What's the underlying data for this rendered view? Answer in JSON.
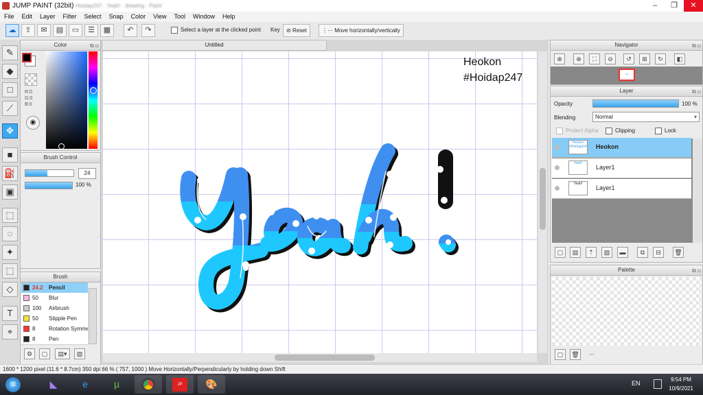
{
  "window": {
    "title": "JUMP PAINT (32bit)",
    "blurred_tabs": "Hoidap247 . Yeah! . drawing - Paint",
    "min": "–",
    "max": "❐",
    "close": "✕"
  },
  "menu": [
    "File",
    "Edit",
    "Layer",
    "Filter",
    "Select",
    "Snap",
    "Color",
    "View",
    "Tool",
    "Window",
    "Help"
  ],
  "toolbar": {
    "select_layer_label": "Select a layer at the clicked point",
    "key_label": "Key",
    "reset_label": "Reset",
    "move_label": "Move horizontally/vertically"
  },
  "color_panel": {
    "title": "Color",
    "r": "R:0",
    "g": "G:0",
    "b": "B:0",
    "fg": "#000000",
    "bg": "#ffffff"
  },
  "brush_control": {
    "title": "Brush Control",
    "size": "24",
    "opacity": "100 %",
    "size_fill": 0.45,
    "opacity_fill": 1.0
  },
  "brush": {
    "title": "Brush",
    "items": [
      {
        "size": "24.2",
        "name": "Pencil",
        "color": "#222222"
      },
      {
        "size": "50",
        "name": "Blur",
        "color": "#f4b6e6"
      },
      {
        "size": "100",
        "name": "Airbrush",
        "color": "#cccccc"
      },
      {
        "size": "50",
        "name": "Stipple Pen",
        "color": "#f2e62e"
      },
      {
        "size": "8",
        "name": "Rotation Symmetry",
        "color": "#ff3333"
      },
      {
        "size": "8",
        "name": "Pen",
        "color": "#222222"
      }
    ]
  },
  "canvas": {
    "tab": "Untitled",
    "watermark_line1": "Heokon",
    "watermark_line2": "#Hoidap247"
  },
  "navigator": {
    "title": "Navigator"
  },
  "layer_panel": {
    "title": "Layer",
    "opacity_label": "Opacity",
    "opacity_value": "100 %",
    "opacity_fill": 1.0,
    "blending_label": "Blending",
    "blending_value": "Normal",
    "protect_alpha": "Protect Alpha",
    "clipping": "Clipping",
    "lock": "Lock",
    "layers": [
      {
        "name": "Heokon",
        "thumb": "Heokon #Hoidap247",
        "selected": true
      },
      {
        "name": "Layer1",
        "thumb": "Yeah!",
        "selected": false
      },
      {
        "name": "Layer1",
        "thumb": "Yeah!",
        "selected": false
      }
    ]
  },
  "palette": {
    "title": "Palette",
    "dash": "---"
  },
  "status": {
    "text": "1600 * 1200 pixel  (11.6 * 8.7cm)  350 dpi  66 %  ( 757, 1000 )  Move Horizontally/Perpendicularly by holding down Shift"
  },
  "taskbar": {
    "lang": "EN",
    "time": "9:54 PM",
    "date": "10/9/2021"
  },
  "colors": {
    "accent": "#3ba3ea",
    "selection": "#86ccf6",
    "letter_top": "#3f8ff0",
    "letter_bottom": "#1ec8ff"
  }
}
